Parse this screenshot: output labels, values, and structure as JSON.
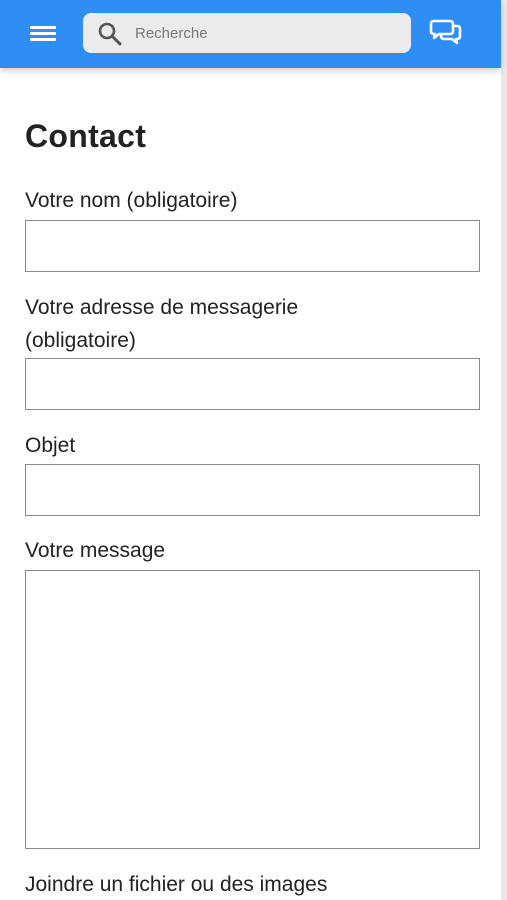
{
  "header": {
    "menu_icon": "hamburger-menu-icon",
    "search": {
      "placeholder": "Recherche",
      "value": "",
      "icon": "search-icon"
    },
    "talk_icon": "speech-bubbles-icon",
    "bar_color": "#2f8ef3"
  },
  "page": {
    "title": "Contact"
  },
  "form": {
    "name_label": "Votre nom (obligatoire)",
    "name_value": "",
    "email_label_line1": "Votre adresse de messagerie",
    "email_label_line2": "(obligatoire)",
    "email_value": "",
    "subject_label": "Objet",
    "subject_value": "",
    "message_label": "Votre message",
    "message_value": "",
    "attach_label": "Joindre un fichier ou des images"
  }
}
